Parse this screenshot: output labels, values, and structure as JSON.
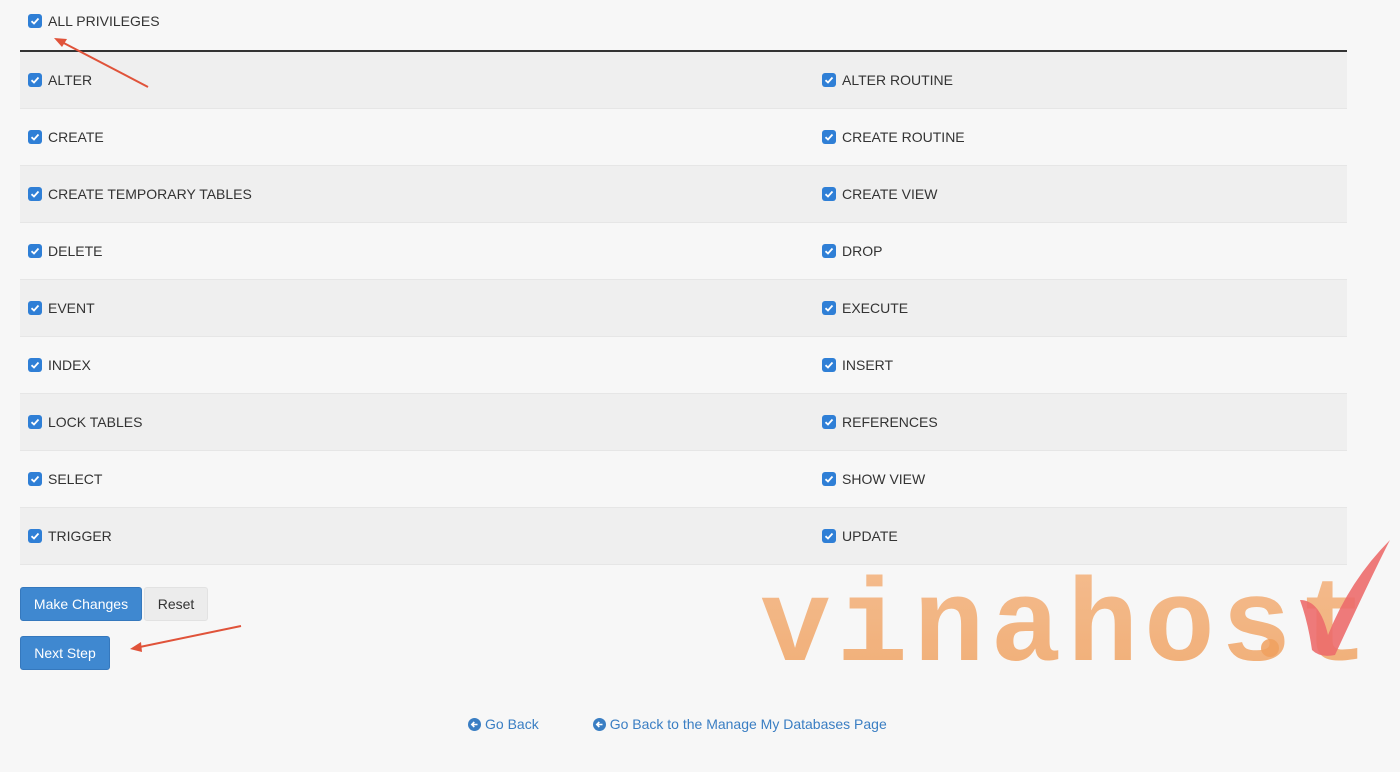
{
  "all_privileges": {
    "label": "ALL PRIVILEGES",
    "checked": true
  },
  "privileges": [
    {
      "left": {
        "label": "ALTER",
        "checked": true
      },
      "right": {
        "label": "ALTER ROUTINE",
        "checked": true
      }
    },
    {
      "left": {
        "label": "CREATE",
        "checked": true
      },
      "right": {
        "label": "CREATE ROUTINE",
        "checked": true
      }
    },
    {
      "left": {
        "label": "CREATE TEMPORARY TABLES",
        "checked": true
      },
      "right": {
        "label": "CREATE VIEW",
        "checked": true
      }
    },
    {
      "left": {
        "label": "DELETE",
        "checked": true
      },
      "right": {
        "label": "DROP",
        "checked": true
      }
    },
    {
      "left": {
        "label": "EVENT",
        "checked": true
      },
      "right": {
        "label": "EXECUTE",
        "checked": true
      }
    },
    {
      "left": {
        "label": "INDEX",
        "checked": true
      },
      "right": {
        "label": "INSERT",
        "checked": true
      }
    },
    {
      "left": {
        "label": "LOCK TABLES",
        "checked": true
      },
      "right": {
        "label": "REFERENCES",
        "checked": true
      }
    },
    {
      "left": {
        "label": "SELECT",
        "checked": true
      },
      "right": {
        "label": "SHOW VIEW",
        "checked": true
      }
    },
    {
      "left": {
        "label": "TRIGGER",
        "checked": true
      },
      "right": {
        "label": "UPDATE",
        "checked": true
      }
    }
  ],
  "buttons": {
    "make_changes": "Make Changes",
    "reset": "Reset",
    "next_step": "Next Step"
  },
  "links": {
    "go_back": "Go Back",
    "go_back_manage": "Go Back to the Manage My Databases Page"
  },
  "watermark": {
    "text": "vinahost"
  },
  "colors": {
    "checkbox": "#2f7fd6",
    "primary_button": "#3f88d0",
    "link": "#3a7ec3",
    "annotation_arrow": "#e0533a",
    "watermark_orange": "#f2a76a",
    "watermark_check": "#ec6b6b"
  },
  "icons": {
    "checkbox": "checkbox-checked-icon",
    "link": "circle-arrow-left-icon"
  }
}
